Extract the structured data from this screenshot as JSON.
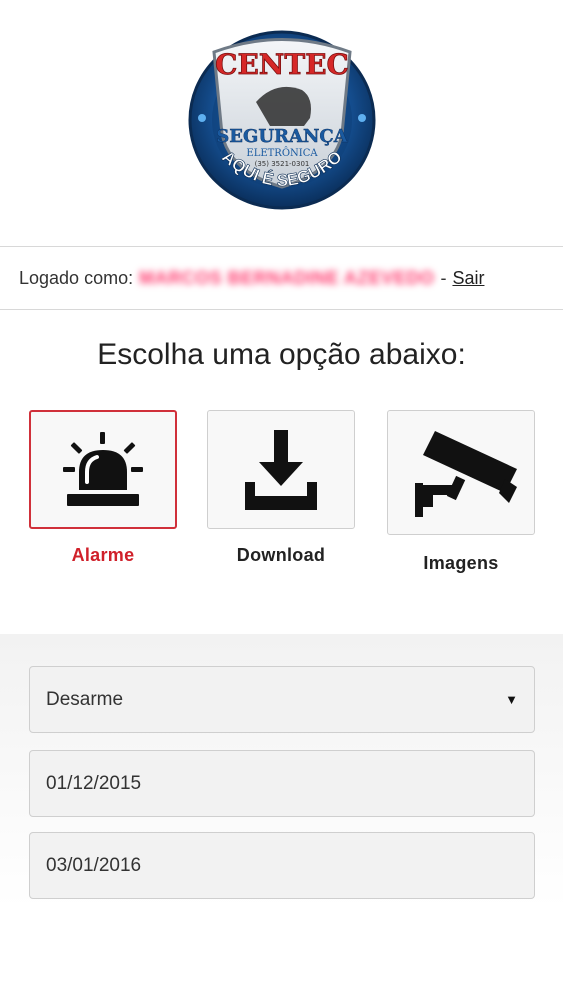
{
  "logo": {
    "brand": "CENTEC",
    "subtitle": "SEGURANÇA",
    "subtitle2": "ELETRÔNICA",
    "phone": "(35) 3521-0301",
    "slogan": "AQUI É SEGURO"
  },
  "login": {
    "prefix": "Logado como:",
    "username": "MARCOS BERNADINE AZEVEDO",
    "separator": "-",
    "logout": "Sair"
  },
  "heading": "Escolha uma opção abaixo:",
  "options": [
    {
      "label": "Alarme",
      "icon": "siren-icon",
      "active": true
    },
    {
      "label": "Download",
      "icon": "download-icon",
      "active": false
    },
    {
      "label": "Imagens",
      "icon": "security-camera-icon",
      "active": false
    }
  ],
  "form": {
    "select_value": "Desarme",
    "date_start": "01/12/2015",
    "date_end": "03/01/2016"
  },
  "colors": {
    "active_accent": "#d0202a",
    "logo_blue": "#1a5aa0",
    "logo_red": "#d62828"
  }
}
